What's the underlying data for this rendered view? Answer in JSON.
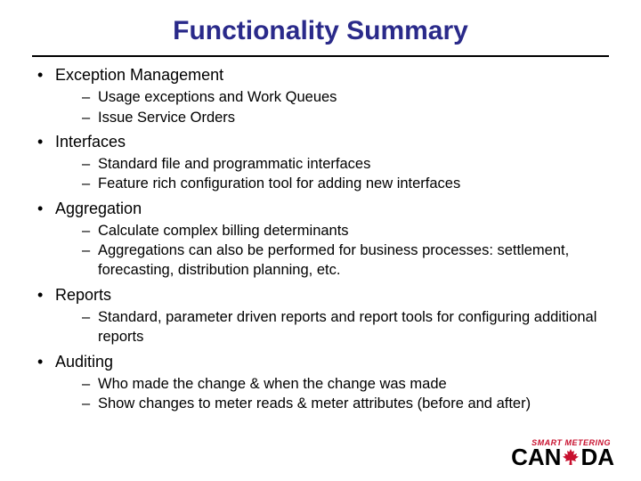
{
  "title": "Functionality Summary",
  "sections": [
    {
      "heading": "Exception Management",
      "subs": [
        "Usage exceptions and Work Queues",
        "Issue Service Orders"
      ]
    },
    {
      "heading": "Interfaces",
      "subs": [
        "Standard file and programmatic interfaces",
        "Feature rich configuration tool for adding new interfaces"
      ]
    },
    {
      "heading": "Aggregation",
      "subs": [
        "Calculate complex billing determinants",
        "Aggregations can also be performed for business processes: settlement, forecasting, distribution planning, etc."
      ]
    },
    {
      "heading": "Reports",
      "subs": [
        "Standard, parameter driven reports and report tools for configuring additional reports"
      ]
    },
    {
      "heading": "Auditing",
      "subs": [
        "Who made the change & when the change was made",
        "Show changes to meter reads & meter attributes (before and after)"
      ]
    }
  ],
  "logo": {
    "topline": "SMART METERING",
    "letters": {
      "c": "C",
      "a1": "A",
      "n": "N",
      "d": "D",
      "a2": "A"
    }
  }
}
